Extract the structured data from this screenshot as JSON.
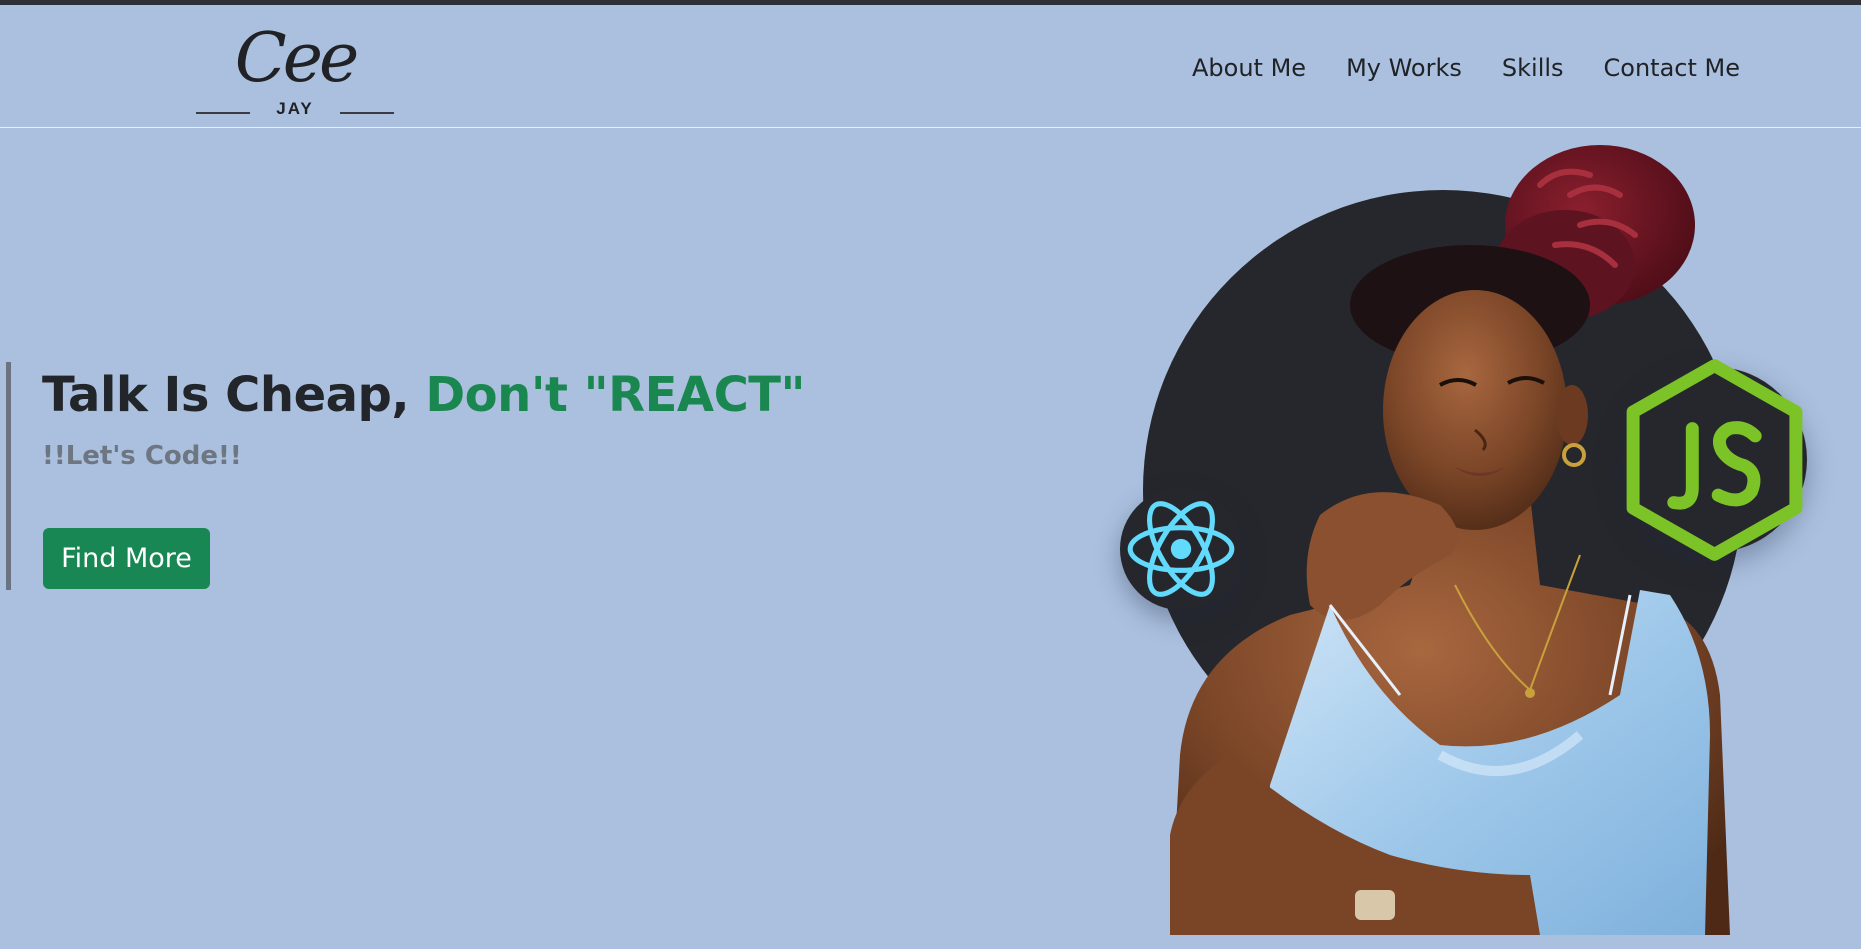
{
  "brand": {
    "logo_script": "Cee",
    "logo_sub": "JAY"
  },
  "nav": {
    "items": [
      {
        "label": "About Me"
      },
      {
        "label": "My Works"
      },
      {
        "label": "Skills"
      },
      {
        "label": "Contact Me"
      }
    ]
  },
  "hero": {
    "heading_main": "Talk Is Cheap, ",
    "heading_accent": "Don't \"REACT\"",
    "subheading": "!!Let's Code!!",
    "cta_label": "Find More"
  },
  "badges": {
    "react_icon": "react-atom-icon",
    "js_icon": "nodejs-hexagon-icon"
  },
  "colors": {
    "page_bg": "#aac0de",
    "accent": "#198754",
    "dark_circle": "#26272c",
    "node_green": "#7cc327",
    "react_blue": "#61dafb"
  }
}
